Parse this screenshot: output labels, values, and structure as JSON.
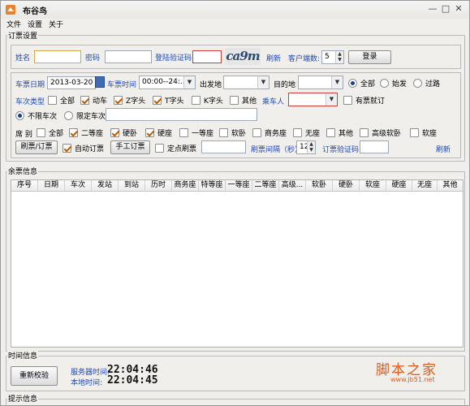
{
  "window": {
    "title": "布谷鸟",
    "minimize": "—",
    "maximize": "□",
    "close": "✕"
  },
  "menu": {
    "items": [
      "文件",
      "设置",
      "关于"
    ]
  },
  "order_settings": {
    "group_title": "订票设置",
    "name_label": "姓名",
    "name_value": "",
    "password_label": "密码",
    "password_value": "",
    "login_captcha_label": "登陆验证码",
    "login_captcha_value": "",
    "captcha_image_text": "ca9m",
    "refresh_label": "刷新",
    "client_count_label": "客户端数:",
    "client_count_value": "5",
    "login_button": "登录",
    "date_label": "车票日期",
    "date_value": "2013-03-20",
    "time_label": "车票时间",
    "time_value": "00:00--24:...",
    "from_label": "出发地",
    "from_value": "",
    "to_label": "目的地",
    "to_value": "",
    "station_options": [
      "全部",
      "始发",
      "过路"
    ],
    "station_selected": 0,
    "train_type_label": "车次类型",
    "train_types": [
      {
        "label": "全部",
        "checked": false
      },
      {
        "label": "动车",
        "checked": true
      },
      {
        "label": "Z字头",
        "checked": true
      },
      {
        "label": "T字头",
        "checked": true
      },
      {
        "label": "K字头",
        "checked": false
      },
      {
        "label": "其他",
        "checked": false
      }
    ],
    "passenger_label": "乘车人",
    "passenger_value": "",
    "has_ticket_label": "有票就订",
    "has_ticket_checked": false,
    "train_limit_options": [
      "不限车次",
      "限定车次"
    ],
    "train_limit_selected": 0,
    "train_limit_value": "",
    "seat_label": "席 别",
    "seats": [
      {
        "label": "全部",
        "checked": false
      },
      {
        "label": "二等座",
        "checked": true
      },
      {
        "label": "硬卧",
        "checked": true
      },
      {
        "label": "硬座",
        "checked": true
      },
      {
        "label": "一等座",
        "checked": false
      },
      {
        "label": "软卧",
        "checked": false
      },
      {
        "label": "商务座",
        "checked": false
      },
      {
        "label": "无座",
        "checked": false
      },
      {
        "label": "其他",
        "checked": false
      },
      {
        "label": "高级软卧",
        "checked": false
      },
      {
        "label": "软座",
        "checked": false
      }
    ],
    "refresh_order_button": "刷票/订票",
    "auto_order_label": "自动订票",
    "auto_order_checked": true,
    "manual_order_button": "手工订票",
    "timed_refresh_label": "定点刷票",
    "timed_refresh_checked": false,
    "timed_refresh_value": "",
    "interval_label": "刷票间隔（秒）",
    "interval_value": "12",
    "order_captcha_label": "订票验证码",
    "order_captcha_value": "",
    "order_refresh_label": "刷新"
  },
  "remaining": {
    "group_title": "余票信息",
    "columns": [
      "序号",
      "日期",
      "车次",
      "发站",
      "到站",
      "历时",
      "商务座",
      "特等座",
      "一等座",
      "二等座",
      "高级...",
      "软卧",
      "硬卧",
      "软座",
      "硬座",
      "无座",
      "其他"
    ]
  },
  "time_info": {
    "group_title": "时间信息",
    "recheck_button": "重新校验",
    "server_time_label": "服务器时间:",
    "server_time_value": "22:04:46",
    "local_time_label": "本地时间:",
    "local_time_value": "22:04:45"
  },
  "tips": {
    "group_title": "提示信息"
  },
  "watermark": {
    "title": "脚本之家",
    "url": "www.jb51.net"
  },
  "colors": {
    "accent_orange": "#e05a19",
    "link_blue": "#1f49b8",
    "captcha_red": "#d43a3a"
  }
}
